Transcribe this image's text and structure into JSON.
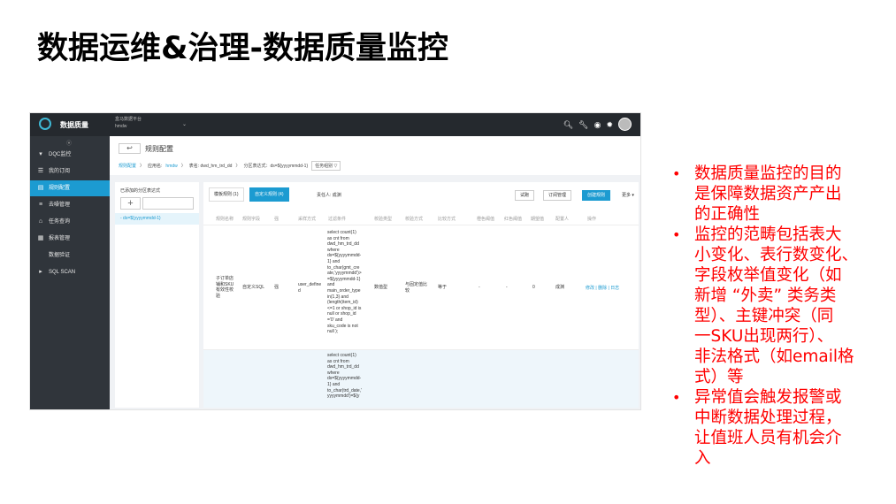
{
  "slide": {
    "title": "数据运维&治理-数据质量监控",
    "bullets": [
      [
        "数据质量监控的目的",
        "是保障数据资产产出",
        "的正确性"
      ],
      [
        "监控的范畴包括表大",
        "小变化、表行数变化、",
        "字段枚举值变化（如",
        "新增 “外卖” 类务类",
        "型）、主键冲突（同",
        "一SKU出现两行）、",
        "非法格式（如email格",
        "式）等"
      ],
      [
        "异常值会触发报警或",
        "中断数据处理过程，",
        "让值班人员有机会介",
        "入"
      ]
    ]
  },
  "app": {
    "name": "数据质量",
    "project_line1": "盒马数据平台",
    "project_line2": "hmdw",
    "icons": [
      "search-icon",
      "wrench-icon",
      "eye-icon",
      "settings-icon",
      "avatar"
    ],
    "sidebar": [
      {
        "label": "DQC监控",
        "icon": "caret-down-icon"
      },
      {
        "label": "我的订阅",
        "icon": "list-icon"
      },
      {
        "label": "规则配置",
        "icon": "doc-icon",
        "active": true
      },
      {
        "label": "去噪管理",
        "icon": "menu-icon"
      },
      {
        "label": "任务查询",
        "icon": "tasks-icon"
      },
      {
        "label": "报表管理",
        "icon": "report-icon"
      },
      {
        "label": "数据验证",
        "icon": ""
      },
      {
        "label": "SQL SCAN",
        "icon": "caret-right-icon"
      }
    ],
    "page_title": "规则配置",
    "back": "↩",
    "breadcrumb": {
      "home": "规则配置",
      "app_label": "应用名:",
      "app_value": "hmdw",
      "table_label": "表名: dwd_hm_trd_dd",
      "partition_label": "分区表达式：ds=${yyyymmdd-1}",
      "task_group": "任务组别 ▽"
    },
    "left_panel": {
      "title": "已添加的分区表达式",
      "plus": "+",
      "item": "- ds=${yyyymmdd-1}"
    },
    "tabs": [
      "模板规则 (1)",
      "自定义规则 (4)"
    ],
    "owner": "责任人: 成渊",
    "buttons": {
      "test": "试跑",
      "sub": "订阅管理",
      "create": "创建规则",
      "more": "更多 ▾"
    },
    "columns": [
      "规则名称",
      "规则字段",
      "强",
      "采样方式",
      "过滤条件",
      "校验类型",
      "校验方式",
      "比较方式",
      "橙色阈值",
      "红色阈值",
      "期望值",
      "配置人",
      "操作"
    ],
    "row1": {
      "name": [
        "子订单店",
        "铺和SKU",
        "有效性校",
        "验"
      ],
      "field": "自定义SQL",
      "strong": "强",
      "sample": [
        "user_define",
        "d"
      ],
      "filter": [
        "select count(1)",
        "as cnt from",
        "dwd_hm_trd_dd",
        "where",
        "ds=${yyyymmdd-",
        "1} and",
        "to_char(gmt_cre",
        "ate,'yyyymmdd')>",
        "=${yyyymmdd-1}",
        "and",
        "main_order_type",
        "in(1,3) and",
        "(length(item_id)",
        "<=1 or shop_id is",
        "null or shop_id",
        "='0' and",
        "sku_code is not",
        "null );"
      ],
      "check_type": "数值型",
      "check_method": [
        "与固定值比",
        "较"
      ],
      "compare": "等于",
      "orange": "-",
      "red": "-",
      "expect": "0",
      "config_by": "成渊",
      "ops": "修改 | 删除 | 日志"
    },
    "row2": {
      "filter": [
        "select count(1)",
        "as cnt from",
        "dwd_hm_trd_dd",
        "where",
        "ds=${yyyymmdd-",
        "1} and",
        "to_char(trd_date,'",
        "yyyymmdd')=${y"
      ]
    }
  }
}
